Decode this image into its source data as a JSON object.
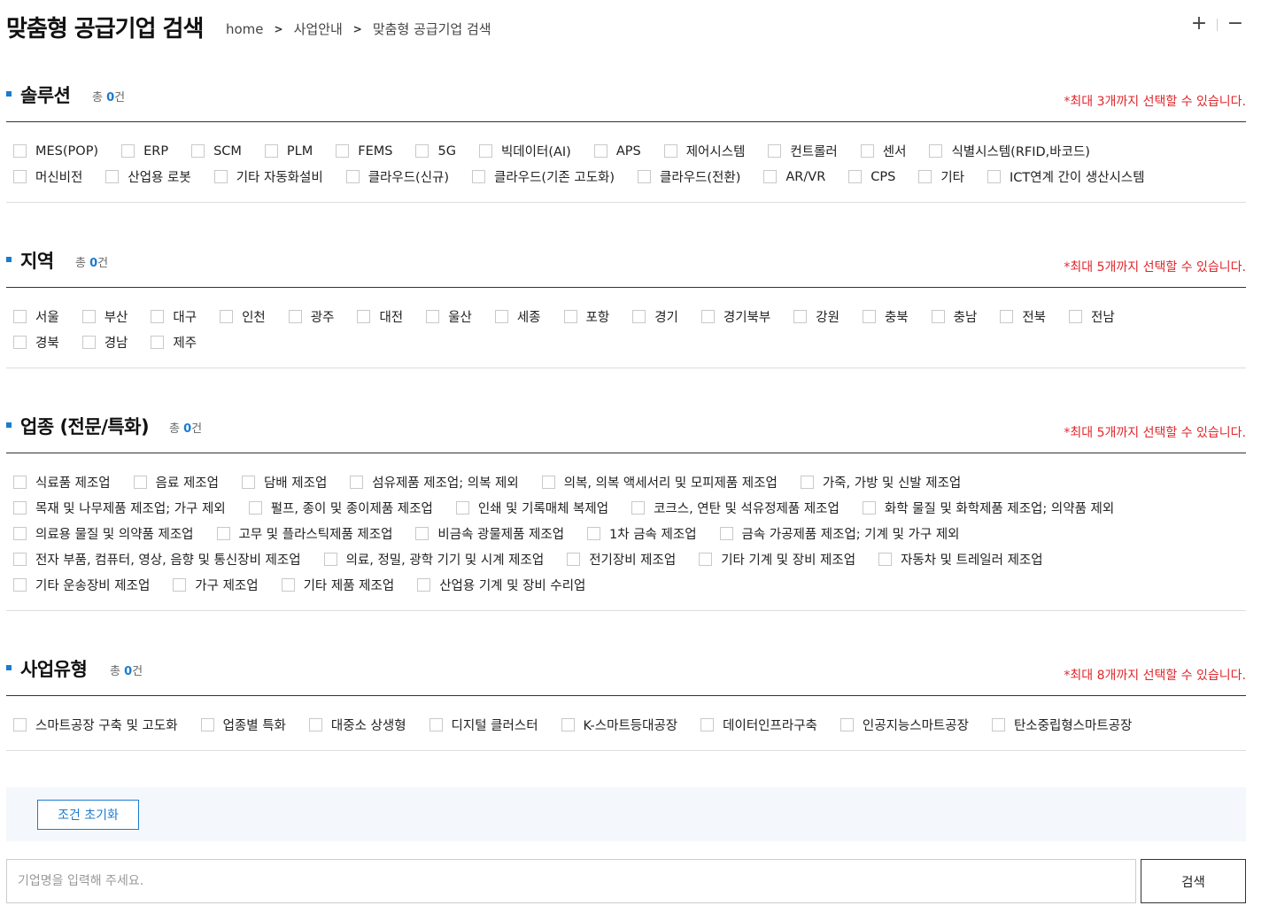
{
  "header": {
    "title": "맞춤형 공급기업 검색",
    "breadcrumb": [
      "home",
      "사업안내",
      "맞춤형 공급기업 검색"
    ],
    "zoom_in": "+",
    "zoom_out": "−"
  },
  "sections": [
    {
      "title": "솔루션",
      "count_prefix": "총 ",
      "count": "0",
      "count_suffix": "건",
      "limit_note": "*최대 3개까지 선택할 수 있습니다.",
      "options": [
        [
          "MES(POP)",
          "ERP",
          "SCM",
          "PLM",
          "FEMS",
          "5G",
          "빅데이터(AI)",
          "APS",
          "제어시스템",
          "컨트롤러",
          "센서",
          "식별시스템(RFID,바코드)"
        ],
        [
          "머신비전",
          "산업용 로봇",
          "기타 자동화설비",
          "클라우드(신규)",
          "클라우드(기존 고도화)",
          "클라우드(전환)",
          "AR/VR",
          "CPS",
          "기타",
          "ICT연계 간이 생산시스템"
        ]
      ]
    },
    {
      "title": "지역",
      "count_prefix": "총 ",
      "count": "0",
      "count_suffix": "건",
      "limit_note": "*최대 5개까지 선택할 수 있습니다.",
      "options": [
        [
          "서울",
          "부산",
          "대구",
          "인천",
          "광주",
          "대전",
          "울산",
          "세종",
          "포항",
          "경기",
          "경기북부",
          "강원",
          "충북",
          "충남",
          "전북",
          "전남"
        ],
        [
          "경북",
          "경남",
          "제주"
        ]
      ]
    },
    {
      "title": "업종 (전문/특화)",
      "count_prefix": "총 ",
      "count": "0",
      "count_suffix": "건",
      "limit_note": "*최대 5개까지 선택할 수 있습니다.",
      "options": [
        [
          "식료품 제조업",
          "음료 제조업",
          "담배 제조업",
          "섬유제품 제조업; 의복 제외",
          "의복, 의복 액세서리 및 모피제품 제조업",
          "가죽, 가방 및 신발 제조업"
        ],
        [
          "목재 및 나무제품 제조업; 가구 제외",
          "펄프, 종이 및 종이제품 제조업",
          "인쇄 및 기록매체 복제업",
          "코크스, 연탄 및 석유정제품 제조업",
          "화학 물질 및 화학제품 제조업; 의약품 제외"
        ],
        [
          "의료용 물질 및 의약품 제조업",
          "고무 및 플라스틱제품 제조업",
          "비금속 광물제품 제조업",
          "1차 금속 제조업",
          "금속 가공제품 제조업; 기계 및 가구 제외"
        ],
        [
          "전자 부품, 컴퓨터, 영상, 음향 및 통신장비 제조업",
          "의료, 정밀, 광학 기기 및 시계 제조업",
          "전기장비 제조업",
          "기타 기계 및 장비 제조업",
          "자동차 및 트레일러 제조업"
        ],
        [
          "기타 운송장비 제조업",
          "가구 제조업",
          "기타 제품 제조업",
          "산업용 기계 및 장비 수리업"
        ]
      ]
    },
    {
      "title": "사업유형",
      "count_prefix": "총 ",
      "count": "0",
      "count_suffix": "건",
      "limit_note": "*최대 8개까지 선택할 수 있습니다.",
      "options": [
        [
          "스마트공장 구축 및 고도화",
          "업종별 특화",
          "대중소 상생형",
          "디지털 클러스터",
          "K-스마트등대공장",
          "데이터인프라구축",
          "인공지능스마트공장",
          "탄소중립형스마트공장"
        ]
      ]
    }
  ],
  "reset_label": "조건 초기화",
  "search": {
    "placeholder": "기업명을 입력해 주세요.",
    "button_label": "검색"
  }
}
